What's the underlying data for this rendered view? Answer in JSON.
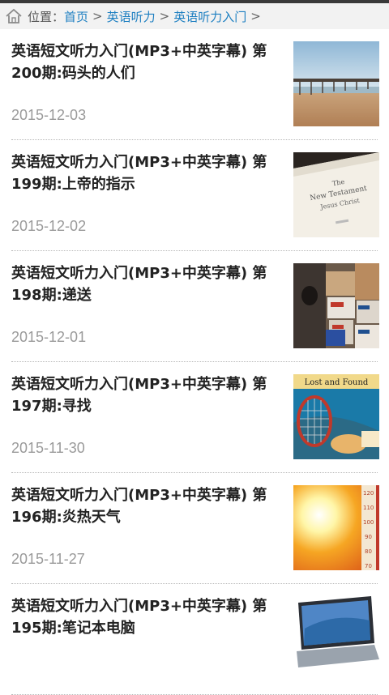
{
  "breadcrumb": {
    "position_label": "位置：",
    "items": [
      "首页",
      "英语听力",
      "英语听力入门"
    ],
    "separator": ">"
  },
  "articles": [
    {
      "title": "英语短文听力入门(MP3+中英字幕) 第200期:码头的人们",
      "date": "2015-12-03",
      "thumb": "pier-beach-image"
    },
    {
      "title": "英语短文听力入门(MP3+中英字幕) 第199期:上帝的指示",
      "date": "2015-12-02",
      "thumb": "new-testament-book-image",
      "thumb_text": [
        "The",
        "New Testament",
        "Jesus Christ"
      ]
    },
    {
      "title": "英语短文听力入门(MP3+中英字幕) 第198期:递送",
      "date": "2015-12-01",
      "thumb": "postal-boxes-image"
    },
    {
      "title": "英语短文听力入门(MP3+中英字幕) 第197期:寻找",
      "date": "2015-11-30",
      "thumb": "lost-and-found-image",
      "thumb_text": [
        "Lost and Found"
      ]
    },
    {
      "title": "英语短文听力入门(MP3+中英字幕) 第196期:炎热天气",
      "date": "2015-11-27",
      "thumb": "sun-thermometer-image",
      "thumb_text": [
        "120",
        "110",
        "100",
        "90",
        "80",
        "70"
      ]
    },
    {
      "title": "英语短文听力入门(MP3+中英字幕) 第195期:笔记本电脑",
      "date": "",
      "thumb": "laptop-image"
    }
  ],
  "colors": {
    "link": "#1d7fc1",
    "title": "#222222",
    "date": "#9a9a9a",
    "breadcrumb_bg": "#f2f2f2"
  }
}
